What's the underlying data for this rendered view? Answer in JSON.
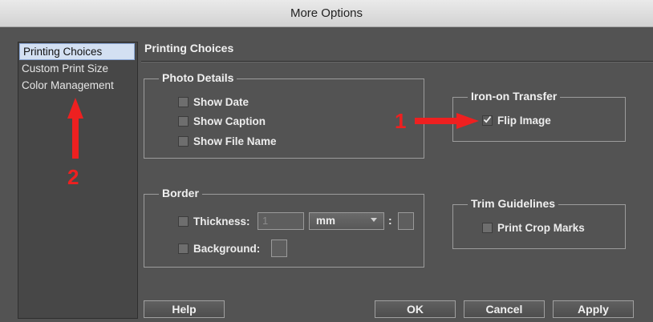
{
  "window": {
    "title": "More Options"
  },
  "sidebar": {
    "items": [
      {
        "label": "Printing Choices",
        "selected": true
      },
      {
        "label": "Custom Print Size",
        "selected": false
      },
      {
        "label": "Color Management",
        "selected": false
      }
    ]
  },
  "main": {
    "title": "Printing Choices",
    "photo_details": {
      "legend": "Photo Details",
      "options": [
        {
          "label": "Show Date",
          "checked": false
        },
        {
          "label": "Show Caption",
          "checked": false
        },
        {
          "label": "Show File Name",
          "checked": false
        }
      ]
    },
    "iron_on": {
      "legend": "Iron-on Transfer",
      "flip_label": "Flip Image",
      "flip_checked": true
    },
    "border": {
      "legend": "Border",
      "thickness_label": "Thickness:",
      "thickness_value": "1",
      "unit_value": "mm",
      "colon": ":",
      "background_label": "Background:"
    },
    "trim": {
      "legend": "Trim Guidelines",
      "crop_label": "Print Crop Marks",
      "crop_checked": false
    }
  },
  "buttons": {
    "help": "Help",
    "ok": "OK",
    "cancel": "Cancel",
    "apply": "Apply"
  },
  "annotations": {
    "one": "1",
    "two": "2",
    "color": "#ee2020"
  }
}
